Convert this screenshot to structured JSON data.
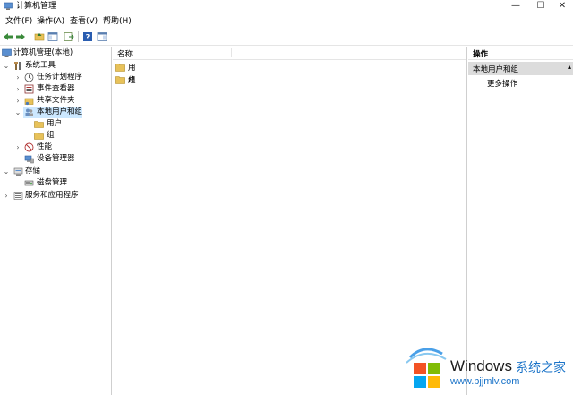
{
  "window": {
    "title": "计算机管理",
    "controls": {
      "minimize": "—",
      "maximize": "☐",
      "close": "✕"
    }
  },
  "menu": [
    "文件(F)",
    "操作(A)",
    "查看(V)",
    "帮助(H)"
  ],
  "tree": {
    "root": "计算机管理(本地)",
    "system_tools": "系统工具",
    "task_scheduler": "任务计划程序",
    "event_viewer": "事件查看器",
    "shared_folders": "共享文件夹",
    "local_users": "本地用户和组",
    "users": "用户",
    "groups": "组",
    "performance": "性能",
    "device_manager": "设备管理器",
    "storage": "存储",
    "disk_management": "磁盘管理",
    "services": "服务和应用程序"
  },
  "list": {
    "column_name": "名称",
    "items": [
      "用户",
      "组"
    ]
  },
  "actions": {
    "header": "操作",
    "section": "本地用户和组",
    "more": "更多操作"
  },
  "watermark": {
    "brand": "Windows",
    "cn": "系统之家",
    "url": "www.bjjmlv.com"
  }
}
